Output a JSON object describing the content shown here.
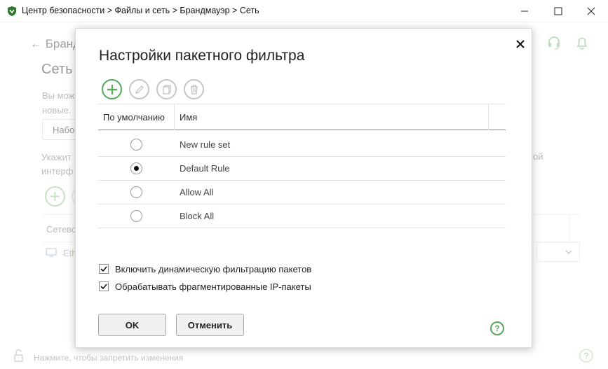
{
  "window": {
    "title": "Центр безопасности > Файлы и сеть > Брандмауэр > Сеть"
  },
  "background": {
    "back_link": "← Бранд",
    "heading": "Сеть",
    "desc_line1": "Вы мож",
    "desc_line2": "новые.",
    "combo_value": "Набо",
    "hint_line1": "Укажит",
    "hint_line2": "интерф",
    "hint_right": "ой",
    "table_col": "Сетево",
    "row_text": "Eth",
    "footer": "Нажмите, чтобы запретить изменения"
  },
  "dialog": {
    "title": "Настройки пакетного фильтра",
    "table": {
      "col_default": "По умолчанию",
      "col_name": "Имя",
      "rows": [
        {
          "name": "New rule set",
          "default": false
        },
        {
          "name": "Default Rule",
          "default": true
        },
        {
          "name": "Allow All",
          "default": false
        },
        {
          "name": "Block All",
          "default": false
        }
      ]
    },
    "options": [
      {
        "label": "Включить динамическую фильтрацию пакетов",
        "checked": true
      },
      {
        "label": "Обрабатывать фрагментированные IP-пакеты",
        "checked": true
      }
    ],
    "ok_label": "OK",
    "cancel_label": "Отменить",
    "help_symbol": "?"
  },
  "colors": {
    "accent_green": "#56a95a",
    "disabled_gray": "#c6c6c6"
  },
  "icons": [
    "app-shield-icon",
    "minimize-icon",
    "maximize-icon",
    "close-icon",
    "headset-icon",
    "bell-icon",
    "add-icon",
    "edit-icon",
    "copy-icon",
    "delete-icon",
    "help-icon",
    "lock-icon",
    "network-icon"
  ]
}
